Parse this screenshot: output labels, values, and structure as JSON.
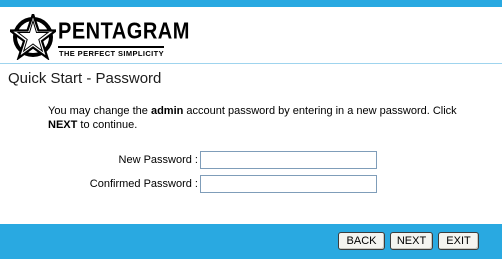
{
  "brand": {
    "name": "PENTAGRAM",
    "tagline": "THE PERFECT SIMPLICITY",
    "logo_icon": "star-in-circle-icon"
  },
  "colors": {
    "accent_bar": "#29a9e1",
    "divider": "#9fd4ee",
    "input_border": "#7f9db9"
  },
  "page": {
    "title": "Quick Start - Password",
    "description": {
      "part1": "You may change the ",
      "bold1": "admin",
      "part2": " account password by entering in a new password. Click ",
      "bold2": "NEXT",
      "part3": " to continue."
    }
  },
  "form": {
    "new_password_label": "New Password :",
    "new_password_value": "",
    "confirmed_password_label": "Confirmed Password :",
    "confirmed_password_value": ""
  },
  "buttons": {
    "back": "BACK",
    "next": "NEXT",
    "exit": "EXIT"
  }
}
